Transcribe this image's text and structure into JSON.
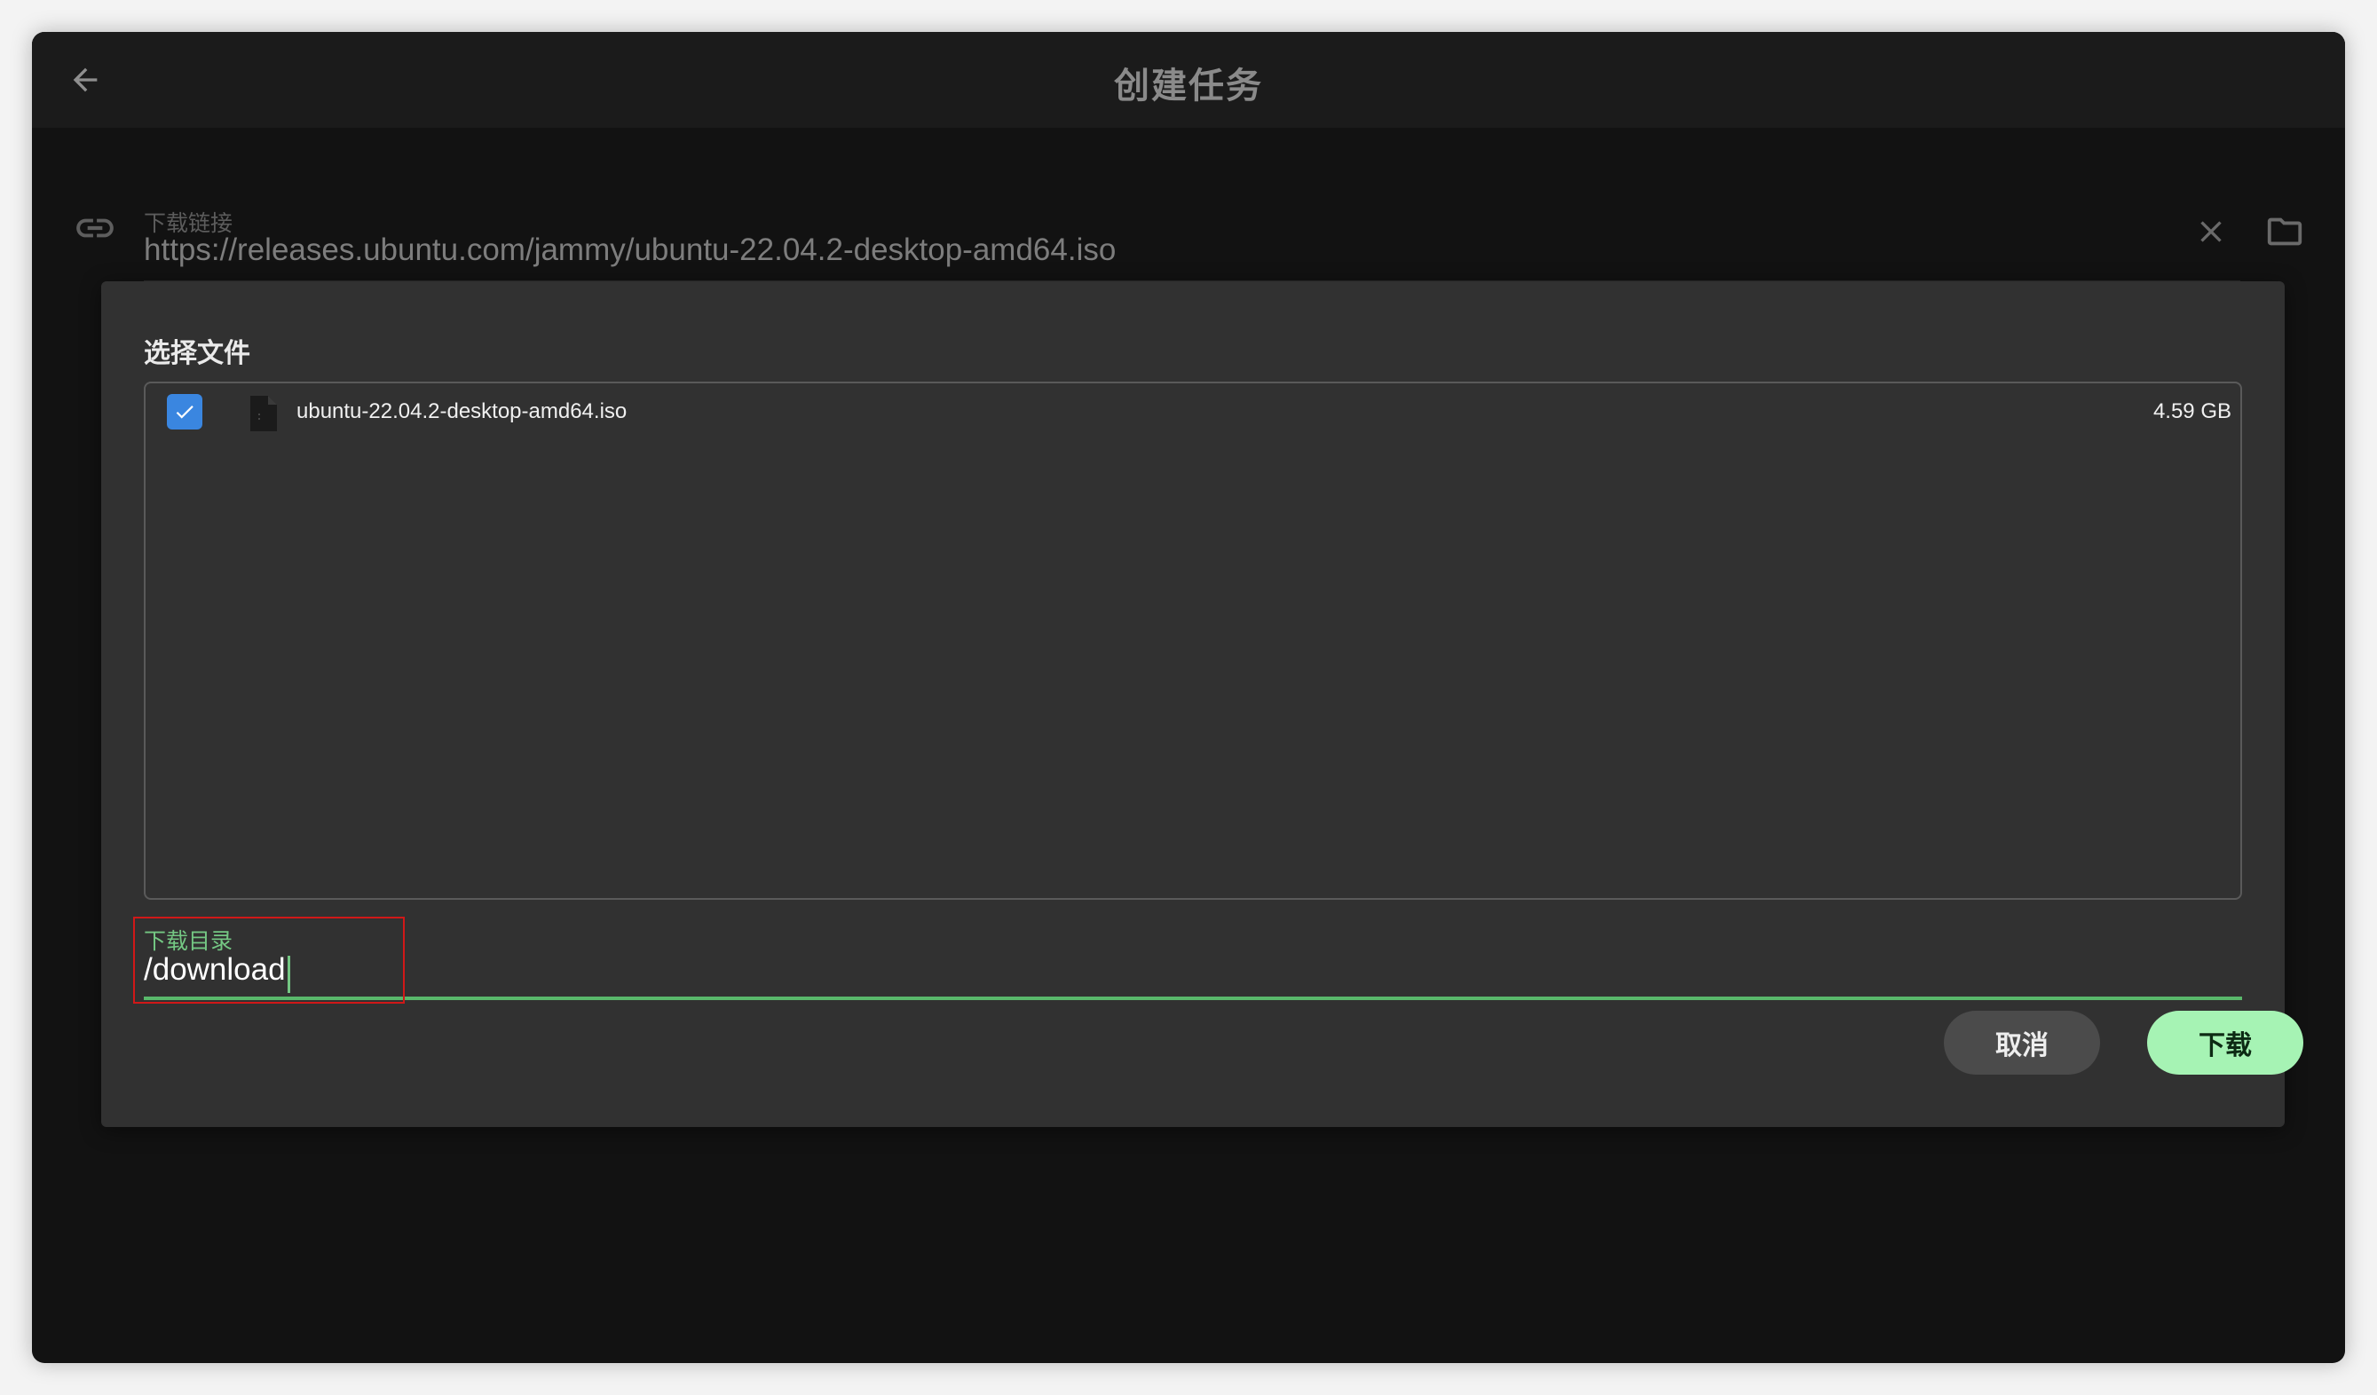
{
  "header": {
    "title": "创建任务",
    "back_icon": "arrow-left-icon"
  },
  "url_field": {
    "label": "下载链接",
    "value": "https://releases.ubuntu.com/jammy/ubuntu-22.04.2-desktop-amd64.iso",
    "leading_icon": "link-icon",
    "clear_icon": "close-icon",
    "browse_icon": "folder-icon"
  },
  "dialog": {
    "title": "选择文件",
    "files": [
      {
        "name": "ubuntu-22.04.2-desktop-amd64.iso",
        "size": "4.59 GB",
        "checked": true,
        "icon": "file-icon"
      }
    ],
    "directory": {
      "label": "下载目录",
      "value": "/download"
    },
    "cancel_label": "取消",
    "download_label": "下载"
  },
  "colors": {
    "window_bg": "#121212",
    "header_bg": "#1b1b1b",
    "dialog_bg": "#313131",
    "accent_green": "#74c783",
    "download_button_bg": "#a6f3b4",
    "cancel_button_bg": "#4b4b4b",
    "checkbox_blue": "#3a86e0",
    "highlight_red": "#d01818"
  }
}
